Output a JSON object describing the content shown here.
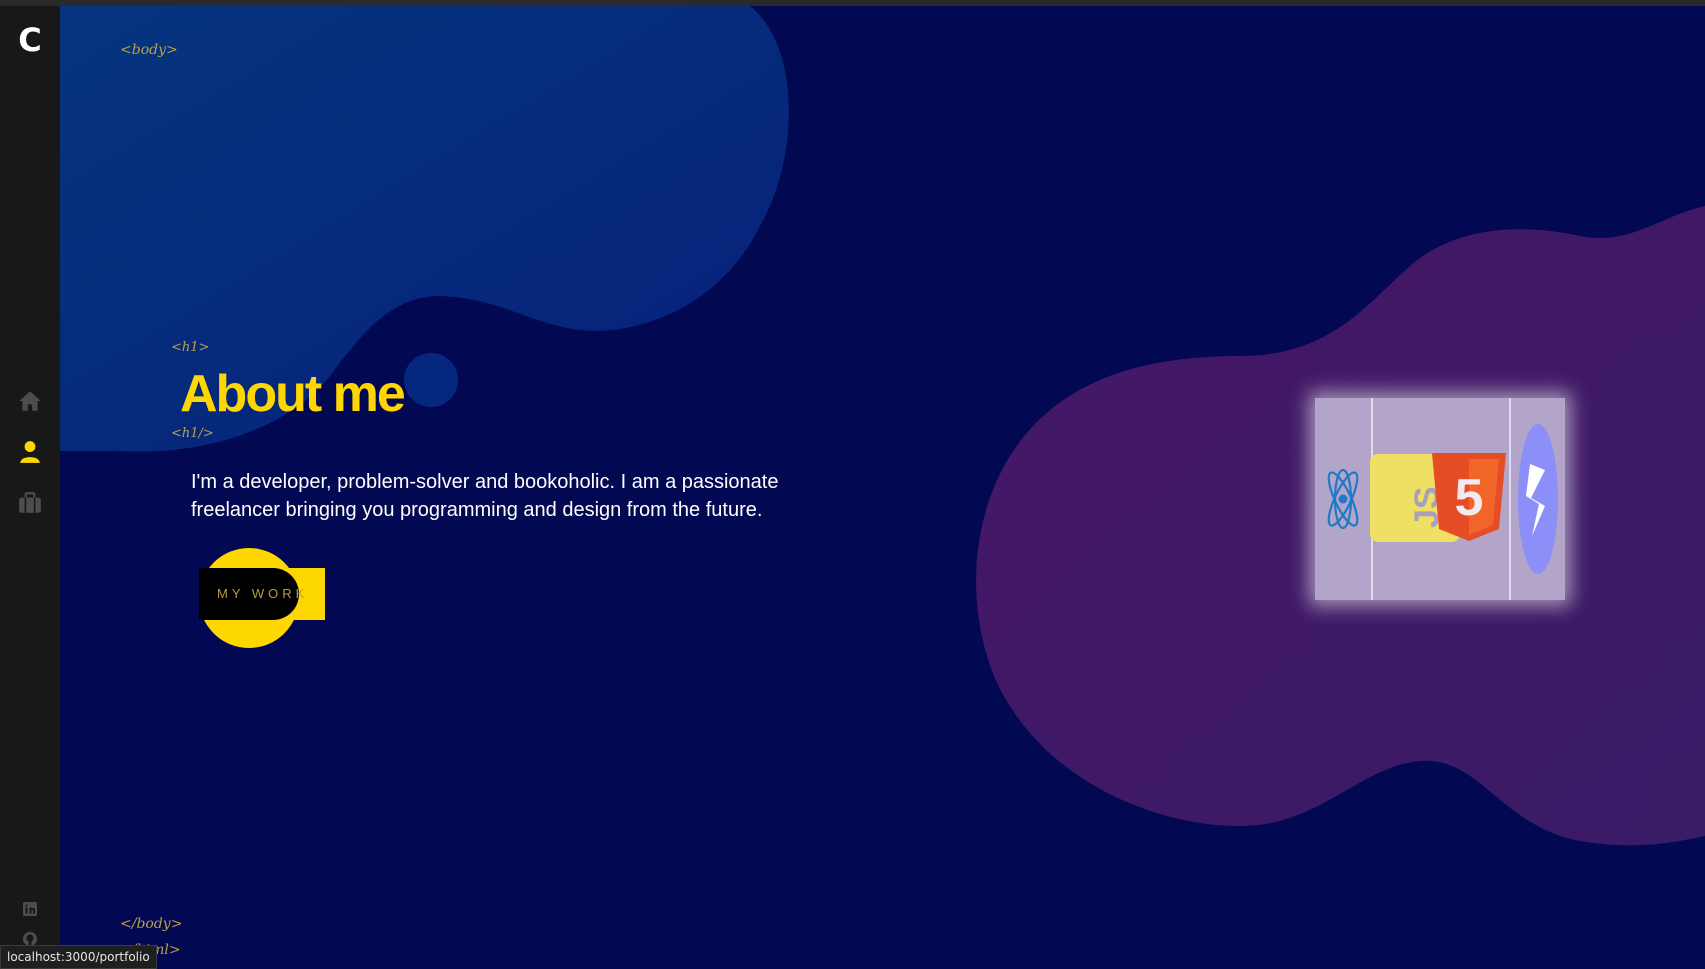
{
  "sidebar": {
    "logo": "C",
    "nav": [
      {
        "name": "home",
        "icon": "home-icon",
        "active": false
      },
      {
        "name": "about",
        "icon": "user-icon",
        "active": true
      },
      {
        "name": "portfolio",
        "icon": "briefcase-icon",
        "active": false
      }
    ],
    "social": [
      {
        "name": "linkedin",
        "icon": "linkedin-icon"
      },
      {
        "name": "github",
        "icon": "github-icon"
      }
    ]
  },
  "tags": {
    "body_open": "<body>",
    "h1_open": "<h1>",
    "h1_close": "<h1/>",
    "body_close": "</body>",
    "html_close": "</html>"
  },
  "hero": {
    "title": "About me",
    "description": "I'm a developer, problem-solver and bookoholic. I am a passionate freelancer bringing you programming and design from the future.",
    "button_label": "MY WORK"
  },
  "skills_cube": {
    "icons": [
      "react-icon",
      "javascript-icon",
      "html5-icon",
      "webflow-icon"
    ],
    "labels": {
      "html5": "5",
      "js": "JS"
    }
  },
  "status_bar": {
    "url": "localhost:3000/portfolio"
  },
  "colors": {
    "background": "#030852",
    "accent": "#ffd700",
    "sidebar": "#181818",
    "blob_blue": "#06277e",
    "blob_purple": "#3e1763",
    "tag_text": "#b7a24a"
  }
}
